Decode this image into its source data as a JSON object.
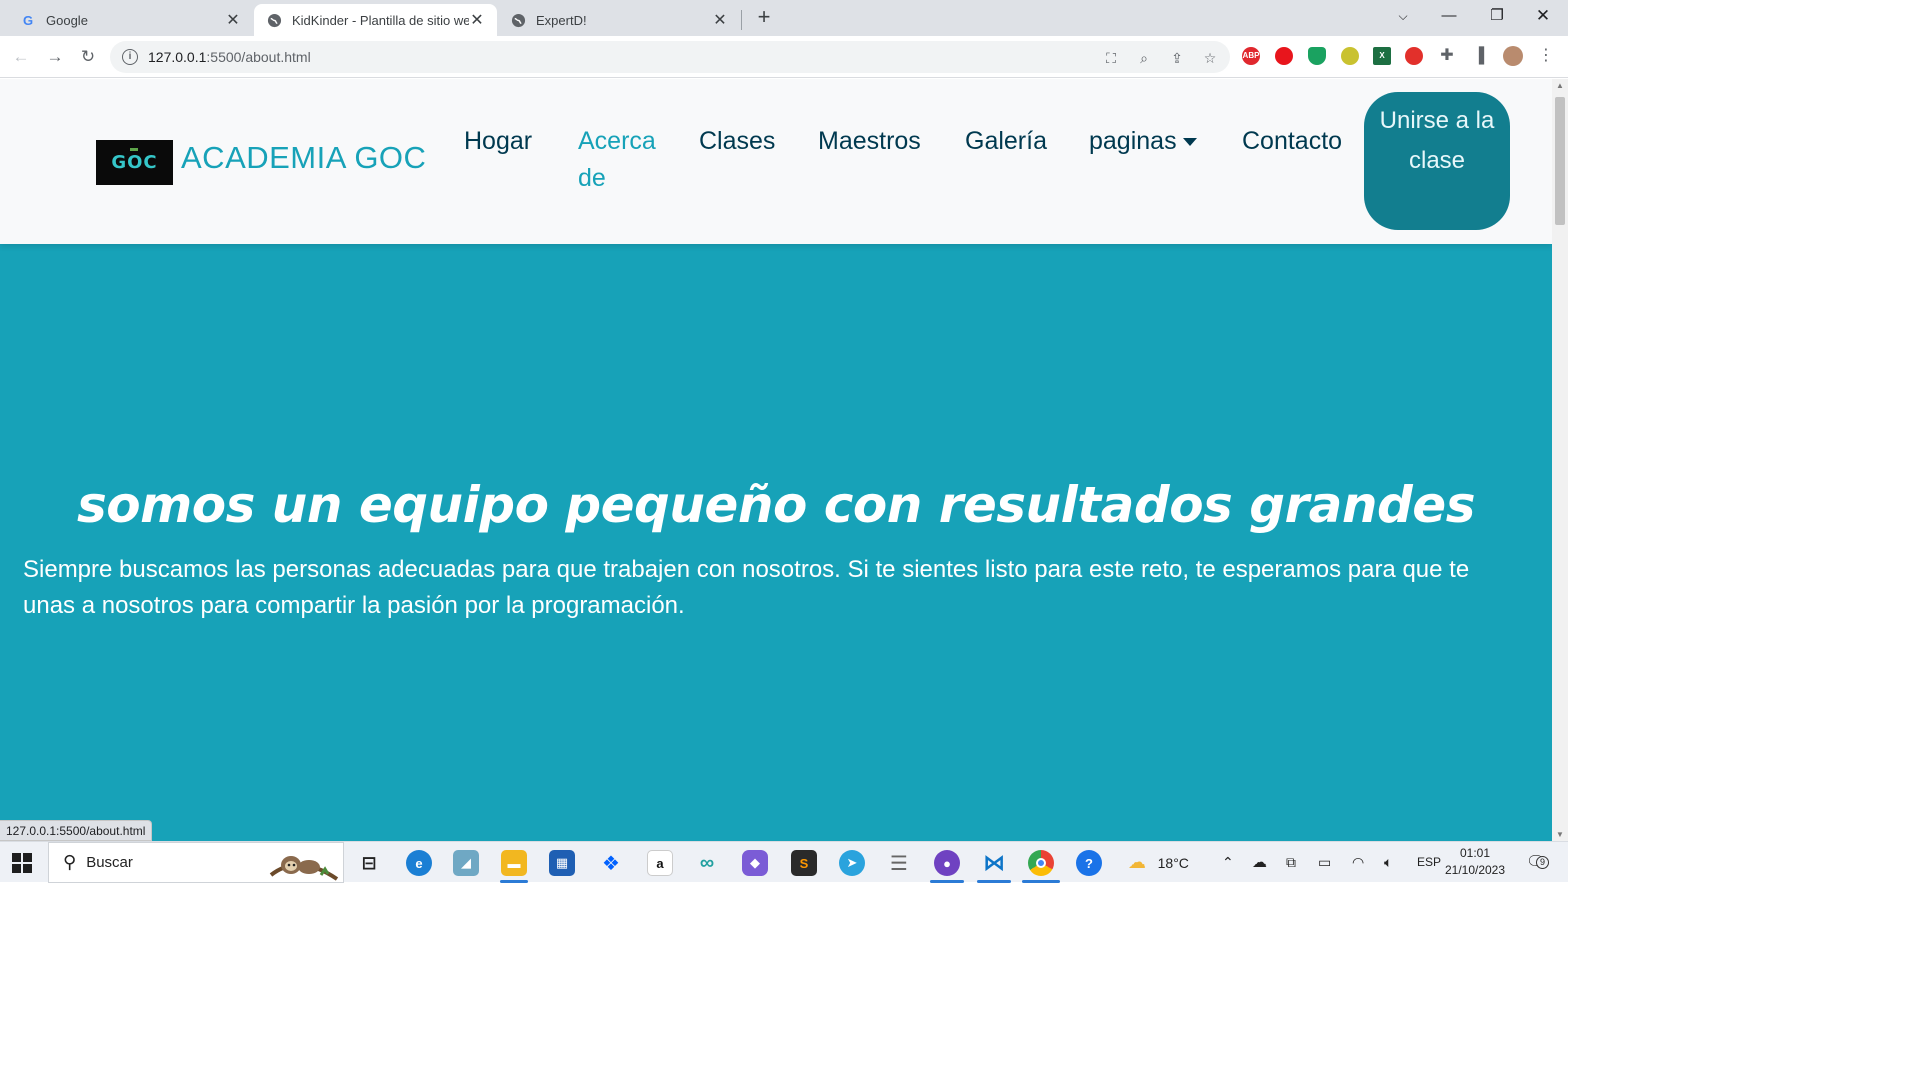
{
  "browser": {
    "tabs": [
      {
        "title": "Google",
        "favicon": "google-icon",
        "active": false
      },
      {
        "title": "KidKinder - Plantilla de sitio web",
        "favicon": "globe-icon",
        "active": true
      },
      {
        "title": "ExpertD!",
        "favicon": "globe-icon",
        "active": false
      }
    ],
    "url_host": "127.0.0.1",
    "url_path": ":5500/about.html",
    "status_url": "127.0.0.1:5500/about.html",
    "extensions": [
      {
        "name": "adblock-plus-icon",
        "label": "ABP",
        "color": "#e0282e"
      },
      {
        "name": "ublock-icon",
        "label": "●",
        "color": "#e8151c"
      },
      {
        "name": "shield-extension-icon",
        "label": "◆",
        "color": "#1aa260"
      },
      {
        "name": "badge-extension-icon",
        "label": "●",
        "color": "#c9c230"
      },
      {
        "name": "excel-extension-icon",
        "label": "X",
        "color": "#1d6f42"
      },
      {
        "name": "location-extension-icon",
        "label": "●",
        "color": "#e2302b"
      }
    ]
  },
  "site": {
    "brand_logo_text": "GOC",
    "brand_name": "ACADEMIA GOC",
    "menu": [
      {
        "label": "Hogar",
        "active": false
      },
      {
        "label": "Acerca de",
        "active": true
      },
      {
        "label": "Clases",
        "active": false
      },
      {
        "label": "Maestros",
        "active": false
      },
      {
        "label": "Galería",
        "active": false
      },
      {
        "label": "paginas",
        "active": false,
        "dropdown": true
      },
      {
        "label": "Contacto",
        "active": false
      }
    ],
    "join_button": "Unirse a la clase",
    "hero_title": "somos un equipo pequeño con resultados grandes",
    "hero_text": "Siempre buscamos las personas adecuadas para que trabajen con nosotros. Si te sientes listo para este reto, te esperamos para que te unas a nosotros para compartir la pasión por la programación.",
    "colors": {
      "accent": "#17a2b8",
      "nav_text": "#00394f",
      "button": "#127e8f"
    }
  },
  "taskbar": {
    "search_placeholder": "Buscar",
    "weather": "18°C",
    "language": "ESP",
    "time": "01:01",
    "date": "21/10/2023",
    "notifications": "9"
  }
}
